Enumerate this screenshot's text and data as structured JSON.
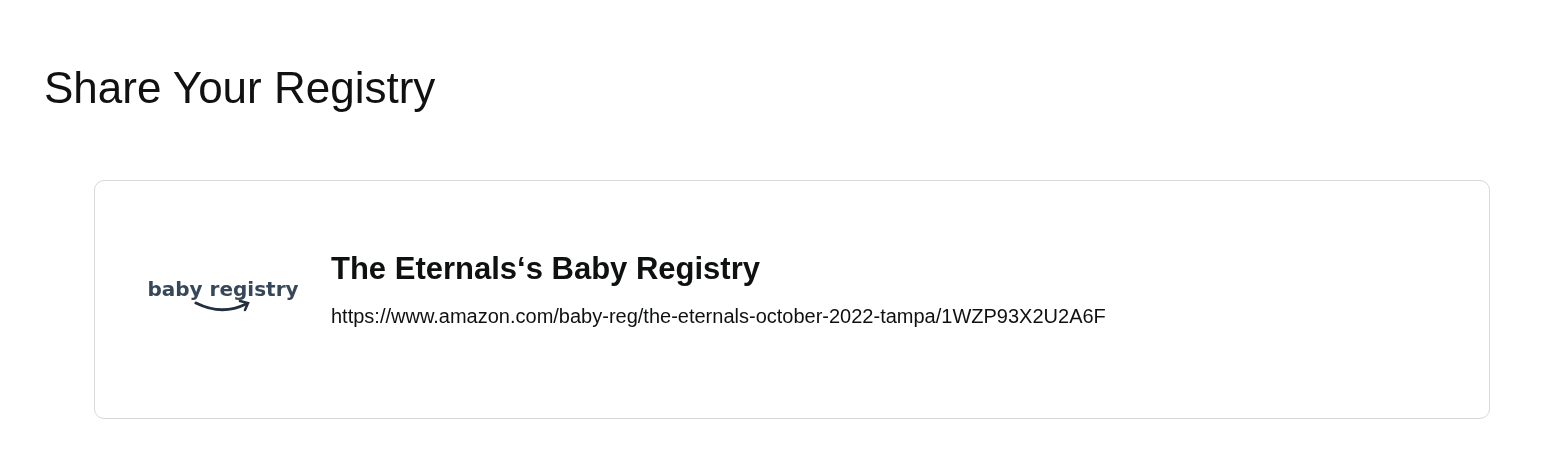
{
  "heading": "Share Your Registry",
  "card": {
    "logo_text": "baby registry",
    "title": "The Eternals‘s Baby Registry",
    "url": "https://www.amazon.com/baby-reg/the-eternals-october-2022-tampa/1WZP93X2U2A6F"
  }
}
